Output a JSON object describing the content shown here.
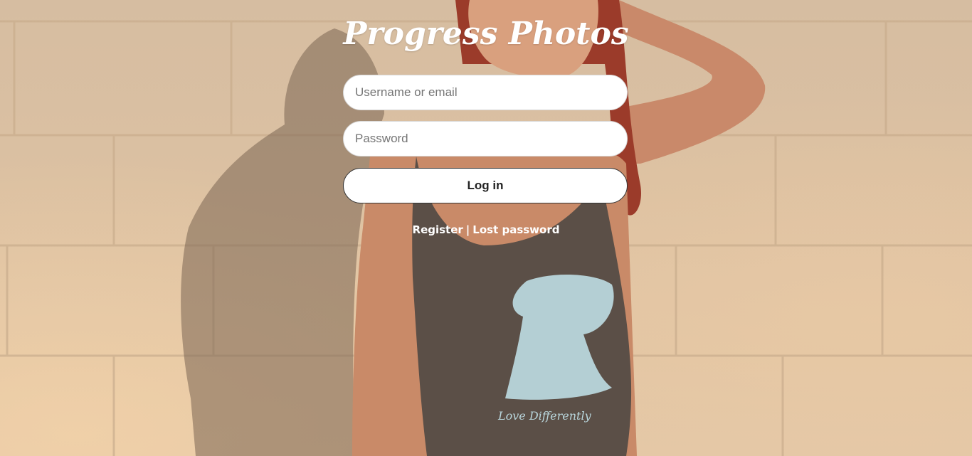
{
  "app": {
    "title": "Progress Photos"
  },
  "login_form": {
    "username_placeholder": "Username or email",
    "username_value": "",
    "password_placeholder": "Password",
    "password_value": "",
    "login_label": "Log in"
  },
  "footer_links": {
    "register_label": "Register",
    "separator": "|",
    "lost_password_label": "Lost password"
  },
  "background": {
    "shirt_text": "Love Differently"
  },
  "colors": {
    "title_text": "#ffffff",
    "button_bg": "#ffffff",
    "button_border": "#333333",
    "wall": "#dcc1a2"
  }
}
